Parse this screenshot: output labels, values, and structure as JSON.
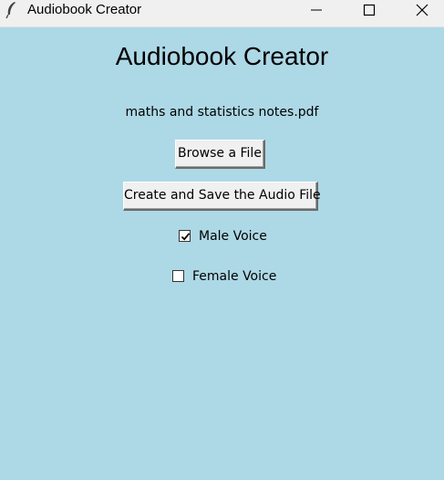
{
  "window": {
    "title": "Audiobook Creator",
    "app_icon": "feather-icon",
    "controls": {
      "minimize_icon": "minimize-icon",
      "maximize_icon": "maximize-icon",
      "close_icon": "close-icon"
    }
  },
  "main": {
    "heading": "Audiobook Creator",
    "selected_file": "maths and statistics notes.pdf",
    "browse_label": "Browse a File",
    "create_label": "Create and Save the Audio File",
    "voices": [
      {
        "label": "Male Voice",
        "checked": true
      },
      {
        "label": "Female Voice",
        "checked": false
      }
    ]
  },
  "colors": {
    "background": "#add8e6",
    "titlebar": "#f0f0f0",
    "button_face": "#f0f0f0"
  }
}
